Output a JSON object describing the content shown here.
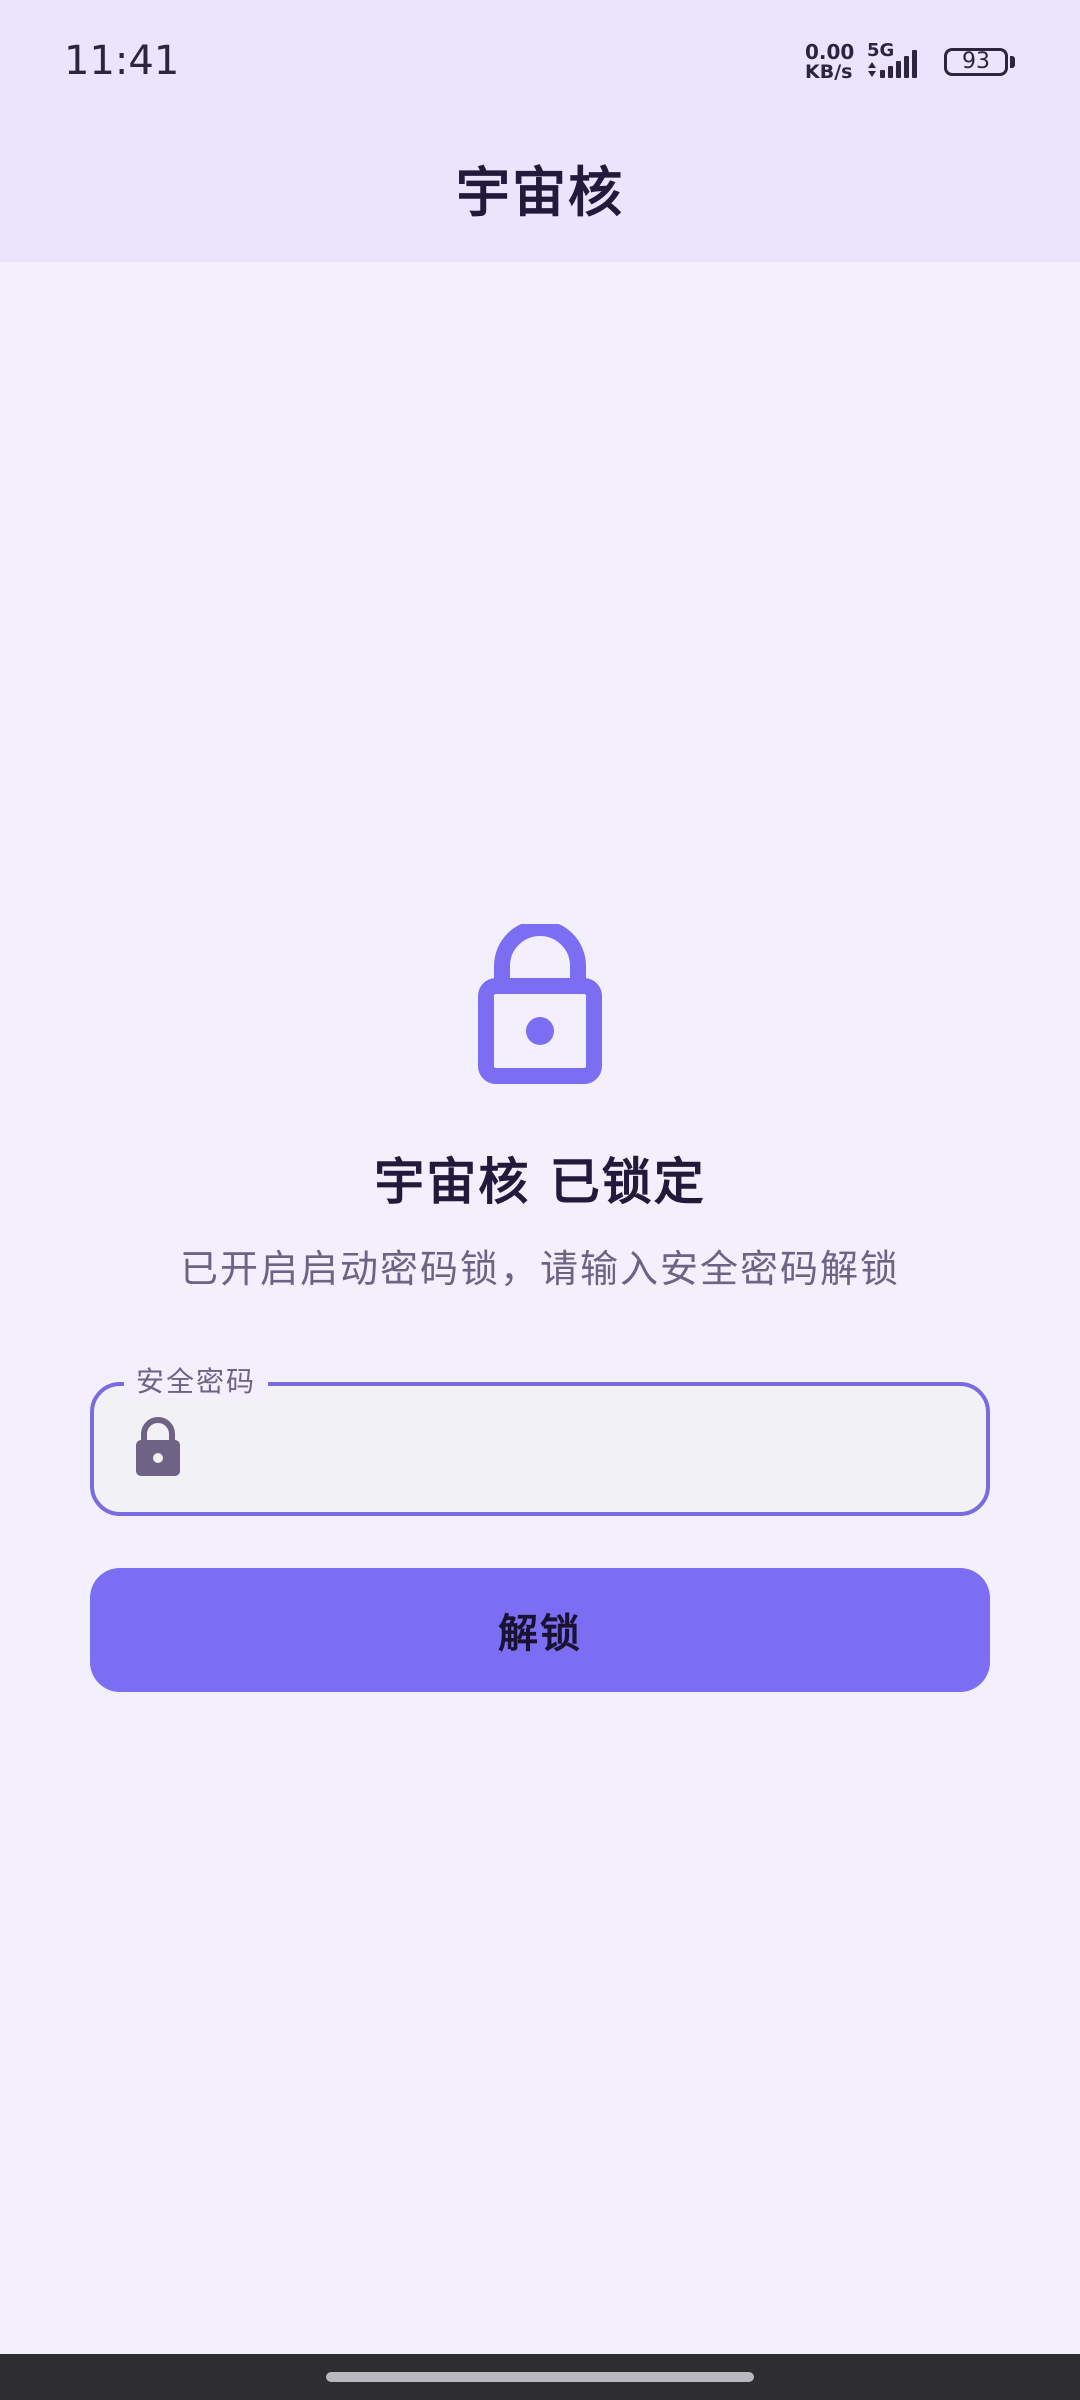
{
  "status_bar": {
    "time": "11:41",
    "net_speed_value": "0.00",
    "net_speed_unit": "KB/s",
    "network_type": "5G",
    "battery_level": "93",
    "signal_icon": "signal-bars-icon",
    "battery_icon": "battery-icon"
  },
  "app_bar": {
    "title": "宇宙核"
  },
  "lock_screen": {
    "icon": "lock-icon",
    "title": "宇宙核 已锁定",
    "subtitle": "已开启启动密码锁，请输入安全密码解锁"
  },
  "password_field": {
    "label": "安全密码",
    "value": "",
    "placeholder": "",
    "icon": "lock-icon"
  },
  "unlock_button": {
    "label": "解锁"
  },
  "colors": {
    "accent": "#7B6EF2",
    "field_border": "#7A6BE0",
    "background": "#F3EFFC",
    "top_bar": "#EBE4FC",
    "title_text": "#221A3B",
    "muted_text": "#6E6285"
  }
}
